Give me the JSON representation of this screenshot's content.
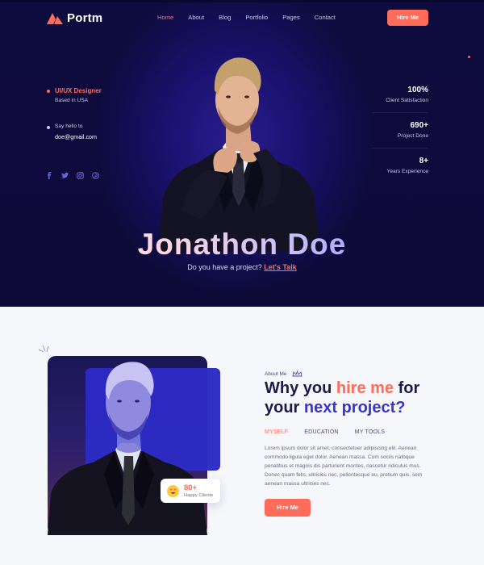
{
  "brand": {
    "name": "Portm"
  },
  "nav": {
    "items": [
      "Home",
      "About",
      "Blog",
      "Portfolio",
      "Pages",
      "Contact"
    ],
    "active_index": 0
  },
  "hero": {
    "hire_button": "Hire Me",
    "role": "UI/UX Designer",
    "location": "Based in USA",
    "hello_label": "Say hello to",
    "email": "doe@gmail.com",
    "socials": [
      "facebook-icon",
      "twitter-icon",
      "instagram-icon",
      "pinterest-icon"
    ],
    "stats": [
      {
        "value": "100%",
        "label": "Client Satisfaction"
      },
      {
        "value": "690+",
        "label": "Project Done"
      },
      {
        "value": "8+",
        "label": "Years Experience"
      }
    ],
    "name": "Jonathon Doe",
    "tagline_prefix": "Do you have a project?",
    "tagline_link": "Let's Talk"
  },
  "about": {
    "label": "About Me",
    "heading_1": "Why you",
    "heading_coral": "hire me",
    "heading_2": "for",
    "heading_3": "your",
    "heading_blue": "next project?",
    "tabs": [
      "MYSELF",
      "EDUCATION",
      "MY TOOLS"
    ],
    "active_tab": 0,
    "paragraph": "Lorem ipsum dolor sit amet, consectetuer adipiscing elit. Aenean commodo ligula eget dolor. Aenean massa. Cum sociis natoque penatibus et magnis dis parturient montes, nascetur ridiculus mus. Donec quam felis, ultricies nec, pellentesque eu, pretium quis, sem aenean massa ultricies nec.",
    "badge_value": "80+",
    "badge_label": "Happy Clients",
    "hire_button": "Hire Me"
  },
  "colors": {
    "accent": "#ff6d5a",
    "hero_bg": "#0e0b3e",
    "blue": "#3c34c9",
    "text_dark": "#1c1a47"
  }
}
